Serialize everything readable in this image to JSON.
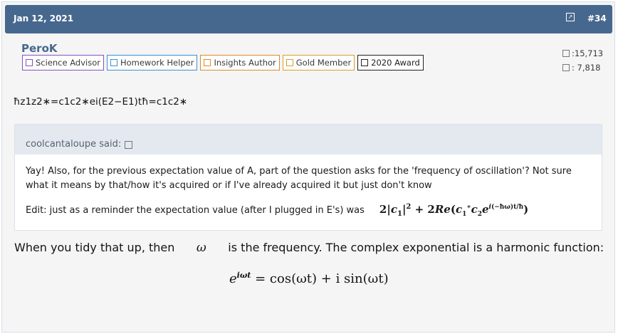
{
  "post": {
    "date": "Jan 12, 2021",
    "number": "#34",
    "share_icon": "share-icon"
  },
  "author": {
    "username": "PeroK",
    "badges": [
      {
        "label": "Science Advisor",
        "color": "#8a4fc0"
      },
      {
        "label": "Homework Helper",
        "color": "#3b8fd0"
      },
      {
        "label": "Insights Author",
        "color": "#e08a2a"
      },
      {
        "label": "Gold Member",
        "color": "#d8a12a"
      },
      {
        "label": "2020 Award",
        "color": "#222222"
      }
    ],
    "stats": {
      "messages": ":15,713",
      "reactions": ":  7,818"
    }
  },
  "content": {
    "mangled_line": "ħz1z2∗=c1c2∗ei(E2−E1)tħ=c1c2∗",
    "quote": {
      "attribution": "coolcantaloupe said:",
      "paragraph1": "Yay! Also, for the previous expectation value of A, part of the question asks for the 'frequency of oscillation'? Not sure what it means by that/how it's acquired or if I've already acquired it but just don't know",
      "edit_text": "Edit: just as a reminder the expectation value (after I plugged in E's) was",
      "math": "2|c₁|² + 2Re(c₁*c₂e^(i(−ħω)t/ħ))"
    },
    "reply_before": "When you tidy that up, then",
    "omega": "ω",
    "reply_after": "is the frequency. The complex exponential is a harmonic function:",
    "equation": {
      "base": "e",
      "exponent": "iωt",
      "rhs": "= cos(ωt) + i sin(ωt)"
    }
  },
  "colors": {
    "header_bg": "#47688e",
    "username": "#47688e",
    "quote_head_bg": "#e4e9f0"
  }
}
